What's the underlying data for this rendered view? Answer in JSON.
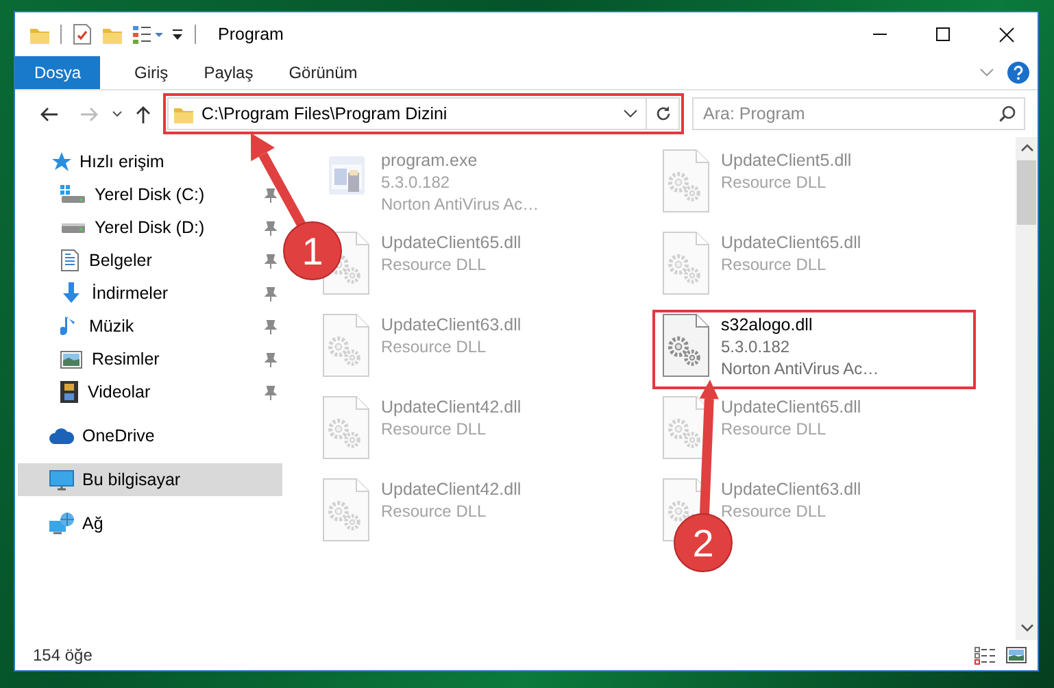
{
  "window": {
    "title": "Program"
  },
  "ribbon": {
    "tabs": [
      {
        "label": "Dosya",
        "selected": true
      },
      {
        "label": "Giriş",
        "selected": false
      },
      {
        "label": "Paylaş",
        "selected": false
      },
      {
        "label": "Görünüm",
        "selected": false
      }
    ]
  },
  "address_bar": {
    "path": "C:\\Program Files\\Program Dizini",
    "highlighted": true
  },
  "search": {
    "placeholder": "Ara: Program"
  },
  "sidebar": {
    "items": [
      {
        "label": "Hızlı erişim",
        "selected": false,
        "children": [
          {
            "label": "Yerel Disk (C:)",
            "pinned": true,
            "selected": false
          },
          {
            "label": "Yerel Disk (D:)",
            "pinned": true,
            "selected": false
          },
          {
            "label": "Belgeler",
            "pinned": true,
            "selected": false
          },
          {
            "label": "İndirmeler",
            "pinned": true,
            "selected": false
          },
          {
            "label": "Müzik",
            "pinned": true,
            "selected": false
          },
          {
            "label": "Resimler",
            "pinned": true,
            "selected": false
          },
          {
            "label": "Videolar",
            "pinned": true,
            "selected": false
          }
        ]
      },
      {
        "label": "OneDrive",
        "selected": false
      },
      {
        "label": "Bu bilgisayar",
        "selected": true
      },
      {
        "label": "Ağ",
        "selected": false
      }
    ]
  },
  "files": [
    {
      "kind": "exe",
      "name": "program.exe",
      "details": [
        "5.3.0.182",
        "Norton AntiVirus Ac…"
      ],
      "dimmed": true,
      "highlighted": false
    },
    {
      "kind": "dll",
      "name": "UpdateClient5.dll",
      "details": [
        "Resource DLL"
      ],
      "dimmed": true,
      "highlighted": false
    },
    {
      "kind": "dll",
      "name": "UpdateClient65.dll",
      "details": [
        "Resource DLL"
      ],
      "dimmed": true,
      "highlighted": false
    },
    {
      "kind": "dll",
      "name": "UpdateClient65.dll",
      "details": [
        "Resource DLL"
      ],
      "dimmed": true,
      "highlighted": false
    },
    {
      "kind": "dll",
      "name": "UpdateClient63.dll",
      "details": [
        "Resource DLL"
      ],
      "dimmed": true,
      "highlighted": false
    },
    {
      "kind": "dll",
      "name": "s32alogo.dll",
      "details": [
        "5.3.0.182",
        "Norton AntiVirus Ac…"
      ],
      "dimmed": false,
      "highlighted": true
    },
    {
      "kind": "dll",
      "name": "UpdateClient42.dll",
      "details": [
        "Resource DLL"
      ],
      "dimmed": true,
      "highlighted": false
    },
    {
      "kind": "dll",
      "name": "UpdateClient65.dll",
      "details": [
        "Resource DLL"
      ],
      "dimmed": true,
      "highlighted": false
    },
    {
      "kind": "dll",
      "name": "UpdateClient42.dll",
      "details": [
        "Resource DLL"
      ],
      "dimmed": true,
      "highlighted": false
    },
    {
      "kind": "dll",
      "name": "UpdateClient63.dll",
      "details": [
        "Resource DLL"
      ],
      "dimmed": true,
      "highlighted": false
    }
  ],
  "status_bar": {
    "count": "154 öğe"
  },
  "annotations": [
    {
      "number": "1"
    },
    {
      "number": "2"
    }
  ]
}
